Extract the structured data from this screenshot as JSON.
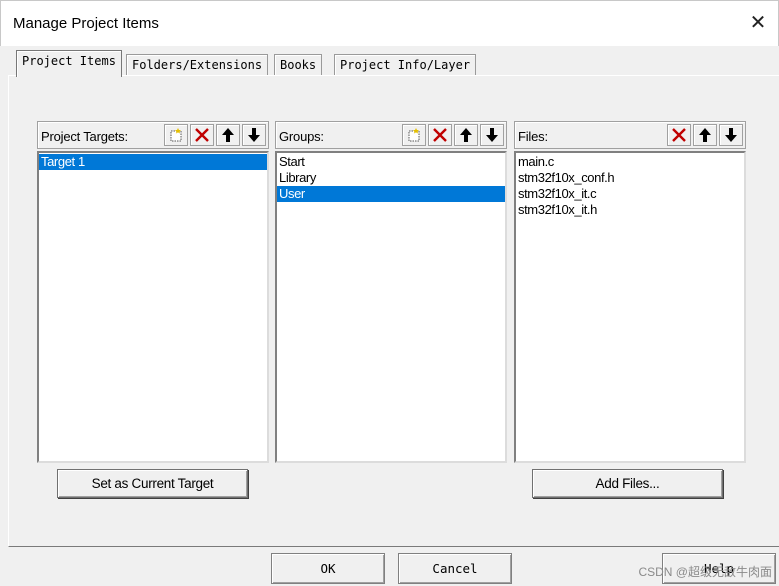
{
  "window": {
    "title": "Manage Project Items",
    "close_label": "✕"
  },
  "tabs": [
    {
      "label": "Project Items",
      "active": true
    },
    {
      "label": "Folders/Extensions",
      "active": false
    },
    {
      "label": "Books",
      "active": false
    },
    {
      "label": "Project Info/Layer",
      "active": false
    }
  ],
  "targets": {
    "label": "Project Targets:",
    "items": [
      "Target 1"
    ],
    "selected_index": 0,
    "action_button": "Set as Current Target"
  },
  "groups": {
    "label": "Groups:",
    "items": [
      "Start",
      "Library",
      "User"
    ],
    "selected_index": 2
  },
  "files": {
    "label": "Files:",
    "items": [
      "main.c",
      "stm32f10x_conf.h",
      "stm32f10x_it.c",
      "stm32f10x_it.h"
    ],
    "action_button": "Add Files..."
  },
  "icons": {
    "new": "new-item-icon",
    "delete": "delete-icon",
    "move_up": "arrow-up-icon",
    "move_down": "arrow-down-icon"
  },
  "colors": {
    "selection": "#0078d7",
    "delete_red": "#c00000"
  },
  "footer": {
    "ok": "OK",
    "cancel": "Cancel",
    "help": "Help"
  },
  "watermark": "CSDN @超级无敌牛肉面"
}
